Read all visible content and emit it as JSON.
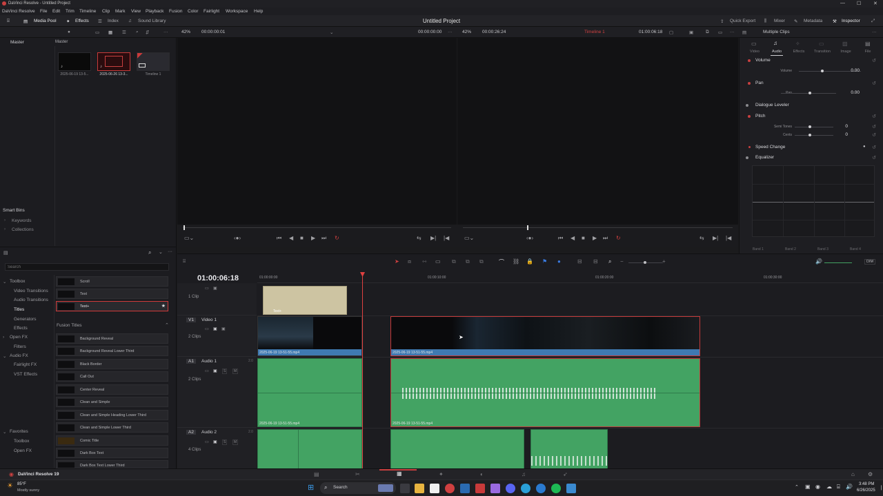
{
  "window": {
    "title": "DaVinci Resolve - Untitled Project"
  },
  "menu": [
    "DaVinci Resolve",
    "File",
    "Edit",
    "Trim",
    "Timeline",
    "Clip",
    "Mark",
    "View",
    "Playback",
    "Fusion",
    "Color",
    "Fairlight",
    "Workspace",
    "Help"
  ],
  "toolbar": {
    "media_pool": "Media Pool",
    "effects": "Effects",
    "index": "Index",
    "sound_library": "Sound Library",
    "project_title": "Untitled Project",
    "quick_export": "Quick Export",
    "mixer": "Mixer",
    "metadata": "Metadata",
    "inspector": "Inspector"
  },
  "subbar": {
    "zoom_left": "42%",
    "tc_left": "00:00:00:01",
    "tc_src": "00:00:00:00",
    "zoom_right": "42%",
    "tc_dur": "00:00:26:24",
    "timeline_name": "Timeline 1",
    "tc_right": "01:00:06:18",
    "inspector_title": "Multiple Clips"
  },
  "media_pool": {
    "header_left": "Master",
    "header_right": "Master",
    "clips": [
      "2025-06-19 13-5...",
      "2025-06-26 13-3...",
      "Timeline 1"
    ],
    "smart_bins": "Smart Bins",
    "keywords": "Keywords",
    "collections": "Collections"
  },
  "inspector": {
    "tabs": [
      "Video",
      "Audio",
      "Effects",
      "Transition",
      "Image",
      "File"
    ],
    "volume": {
      "label": "Volume",
      "param": "Volume",
      "value": "0.00"
    },
    "pan": {
      "label": "Pan",
      "param": "Pan",
      "value": "0.00"
    },
    "dialogue_leveler": "Dialogue Leveler",
    "pitch": {
      "label": "Pitch",
      "semi_label": "Semi Tones",
      "semi_value": "0",
      "cents_label": "Cents",
      "cents_value": "0"
    },
    "speed_change": "Speed Change",
    "equalizer": "Equalizer",
    "bands": [
      "Band 1",
      "Band 2",
      "Band 3",
      "Band 4"
    ]
  },
  "effects_panel": {
    "search_placeholder": "Search",
    "tree": {
      "toolbox": "Toolbox",
      "video_transitions": "Video Transitions",
      "audio_transitions": "Audio Transitions",
      "titles": "Titles",
      "generators": "Generators",
      "effects": "Effects",
      "open_fx": "Open FX",
      "filters": "Filters",
      "audio_fx": "Audio FX",
      "fairlight_fx": "Fairlight FX",
      "vst_effects": "VST Effects",
      "favorites": "Favorites",
      "fav_toolbox": "Toolbox",
      "fav_open_fx": "Open FX"
    },
    "items_top": [
      "Scroll",
      "Text",
      "Text+"
    ],
    "fusion_titles_header": "Fusion Titles",
    "fusion_titles": [
      "Background Reveal",
      "Background Reveal Lower Third",
      "Black Border",
      "Call Out",
      "Center Reveal",
      "Clean and Simple",
      "Clean and Simple Heading Lower Third",
      "Clean and Simple Lower Third",
      "Comic Title",
      "Dark Box Text",
      "Dark Box Text Lower Third"
    ]
  },
  "timeline": {
    "timecode": "01:00:06:18",
    "ruler": [
      "01:00:00:00",
      "01:00:10:00",
      "01:00:20:00",
      "01:00:30:00"
    ],
    "tracks": {
      "title_track": {
        "count": "1 Clip"
      },
      "v1": {
        "badge": "V1",
        "name": "Video 1",
        "count": "2 Clips"
      },
      "a1": {
        "badge": "A1",
        "name": "Audio 1",
        "level": "2.0",
        "count": "2 Clips"
      },
      "a2": {
        "badge": "A2",
        "name": "Audio 2",
        "level": "2.0",
        "count": "4 Clips"
      }
    },
    "clips": {
      "text_clip": "Text+",
      "v1_clip1": "2025-06-19 13-51-55.mp4",
      "v1_clip2": "2025-06-19 13-51-55.mp4",
      "a1_clip1": "2025-06-19 13-51-55.mp4",
      "a1_clip2": "2025-06-19 13-51-55.mp4"
    },
    "dim_label": "DIM"
  },
  "bottom": {
    "app_name": "DaVinci Resolve 19"
  },
  "taskbar": {
    "weather_temp": "85°F",
    "weather_desc": "Mostly sunny",
    "search": "Search",
    "time": "3:48 PM",
    "date": "6/26/2025"
  },
  "colors": {
    "accent_red": "#c93a3a",
    "audio_green": "#43a363",
    "video_blue": "#3f7ab2"
  }
}
